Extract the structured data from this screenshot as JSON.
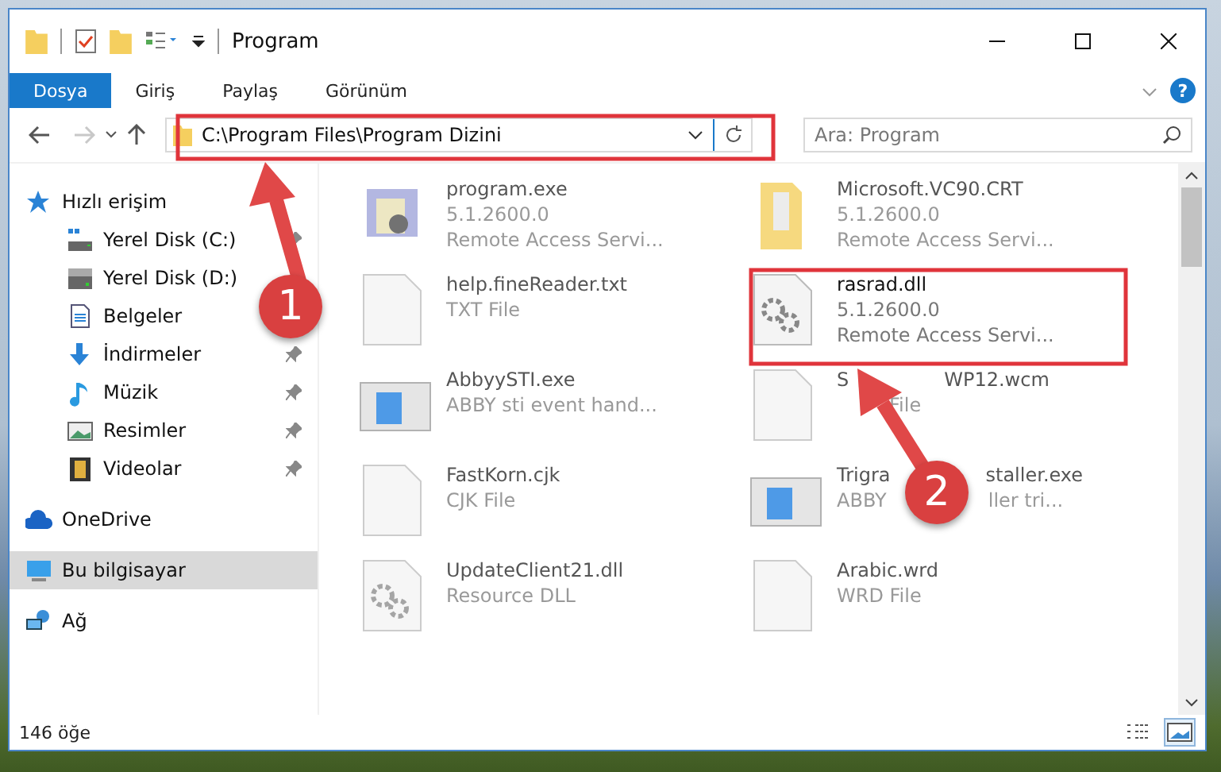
{
  "window": {
    "title": "Program"
  },
  "ribbon": {
    "tabs": [
      {
        "label": "Dosya",
        "selected": true
      },
      {
        "label": "Giriş",
        "selected": false
      },
      {
        "label": "Paylaş",
        "selected": false
      },
      {
        "label": "Görünüm",
        "selected": false
      }
    ],
    "help_label": "?"
  },
  "address": {
    "path": "C:\\Program Files\\Program Dizini",
    "forward_disabled": true
  },
  "search": {
    "placeholder": "Ara: Program"
  },
  "sidebar": {
    "items": [
      {
        "label": "Hızlı erişim",
        "kind": "star",
        "selected": false,
        "children": [
          {
            "label": "Yerel Disk (C:)",
            "kind": "system-drive",
            "pinned": true,
            "selected": false
          },
          {
            "label": "Yerel Disk (D:)",
            "kind": "drive",
            "pinned": false,
            "selected": false
          },
          {
            "label": "Belgeler",
            "kind": "document",
            "pinned": false,
            "selected": false
          },
          {
            "label": "İndirmeler",
            "kind": "download",
            "pinned": true,
            "selected": false
          },
          {
            "label": "Müzik",
            "kind": "music",
            "pinned": true,
            "selected": false
          },
          {
            "label": "Resimler",
            "kind": "pictures",
            "pinned": true,
            "selected": false
          },
          {
            "label": "Videolar",
            "kind": "videos",
            "pinned": true,
            "selected": false
          }
        ]
      },
      {
        "label": "OneDrive",
        "kind": "cloud",
        "selected": false
      },
      {
        "label": "Bu bilgisayar",
        "kind": "computer",
        "selected": true
      },
      {
        "label": "Ağ",
        "kind": "network",
        "selected": false
      }
    ]
  },
  "files": [
    {
      "name": [
        "program.exe"
      ],
      "details": [
        {
          "parts": [
            "5.1.2600.0"
          ]
        },
        {
          "parts": [
            "Remote Access Servi..."
          ]
        }
      ],
      "kind": "app",
      "blurred": true
    },
    {
      "name": [
        "Microsoft.VC90.CRT"
      ],
      "details": [
        {
          "parts": [
            "5.1.2600.0"
          ]
        },
        {
          "parts": [
            "Remote Access Servi..."
          ]
        }
      ],
      "kind": "folder",
      "blurred": true
    },
    {
      "name": [
        "help.fineReader.txt"
      ],
      "details": [
        {
          "parts": [
            "TXT File"
          ]
        }
      ],
      "kind": "text",
      "blurred": true
    },
    {
      "name": [
        "rasrad.dll"
      ],
      "details": [
        {
          "parts": [
            "5.1.2600.0"
          ]
        },
        {
          "parts": [
            "Remote Access Servi..."
          ]
        }
      ],
      "kind": "dll",
      "blurred": false
    },
    {
      "name": [
        "AbbyySTI.exe"
      ],
      "details": [
        {
          "parts": [
            "ABBY sti event hand..."
          ]
        }
      ],
      "kind": "window",
      "blurred": true
    },
    {
      "name": [
        "S",
        "WP12.wcm"
      ],
      "details": [
        {
          "parts": [
            "File"
          ],
          "hidden_start": true
        }
      ],
      "kind": "text",
      "blurred": true
    },
    {
      "name": [
        "FastKorn.cjk"
      ],
      "details": [
        {
          "parts": [
            "CJK File"
          ]
        }
      ],
      "kind": "text",
      "blurred": true
    },
    {
      "name": [
        "Trigra",
        "staller.exe"
      ],
      "details": [
        {
          "parts": [
            "ABBY",
            "ller tri..."
          ]
        }
      ],
      "kind": "window",
      "blurred": true
    },
    {
      "name": [
        "UpdateClient21.dll"
      ],
      "details": [
        {
          "parts": [
            "Resource DLL"
          ]
        }
      ],
      "kind": "dll",
      "blurred": true
    },
    {
      "name": [
        "Arabic.wrd"
      ],
      "details": [
        {
          "parts": [
            "WRD File"
          ]
        }
      ],
      "kind": "text",
      "blurred": true
    }
  ],
  "status_bar": {
    "count": "146 öğe",
    "views": [
      {
        "kind": "details",
        "selected": false
      },
      {
        "kind": "large-icons",
        "selected": true
      }
    ]
  },
  "annotations": [
    {
      "label": "1"
    },
    {
      "label": "2"
    }
  ]
}
